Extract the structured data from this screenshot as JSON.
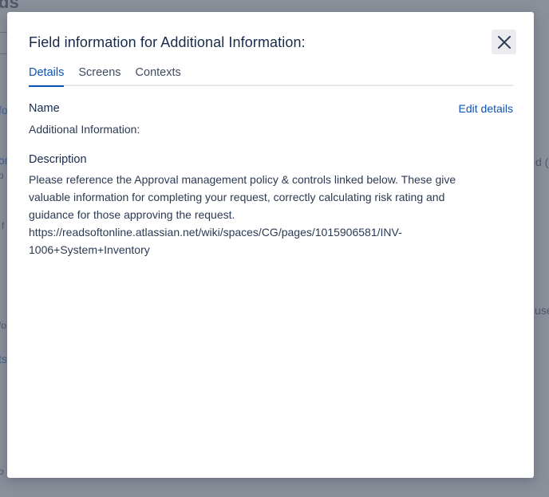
{
  "background": {
    "title_fragment": "ds",
    "fragments": [
      "fo",
      "on",
      "p",
      "f",
      "d (?",
      "fo",
      "ts",
      "use",
      "o"
    ]
  },
  "modal": {
    "title": "Field information for Additional Information:",
    "close_icon": "close-icon",
    "tabs": [
      {
        "label": "Details",
        "active": true
      },
      {
        "label": "Screens",
        "active": false
      },
      {
        "label": "Contexts",
        "active": false
      }
    ],
    "name_label": "Name",
    "name_value": "Additional Information:",
    "edit_label": "Edit details",
    "description_label": "Description",
    "description_lines": [
      "Please reference the Approval management policy & controls linked below. These give",
      "valuable information for completing your request, correctly calculating risk rating and",
      "guidance for those approving the request.",
      "https://readsoftonline.atlassian.net/wiki/spaces/CG/pages/1015906581/INV-",
      "1006+System+Inventory"
    ]
  },
  "colors": {
    "accent": "#0c53b7",
    "backdrop": "#8a8f99",
    "title_text": "#172b4d"
  }
}
